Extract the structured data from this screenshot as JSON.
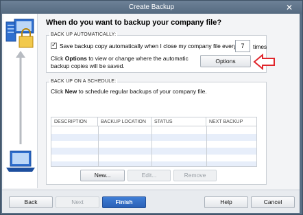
{
  "window": {
    "title": "Create Backup",
    "close_glyph": "✕"
  },
  "heading": "When do you want to backup your company file?",
  "auto_section": {
    "label": "BACK UP AUTOMATICALLY:",
    "checkbox_label": "Save backup copy automatically when I close my company file every",
    "times_value": "7",
    "times_label": "times",
    "description_prefix": "Click ",
    "description_bold": "Options",
    "description_rest_line1": " to view or change where the automatic",
    "description_line2": "backup copies will be saved.",
    "options_button": "Options"
  },
  "schedule_section": {
    "label": "BACK UP ON A SCHEDULE:",
    "description_prefix": "Click ",
    "description_bold": "New",
    "description_rest": " to schedule regular backups of your company file.",
    "columns": [
      "DESCRIPTION",
      "BACKUP LOCATION",
      "STATUS",
      "NEXT BACKUP"
    ],
    "rows": [
      [],
      [],
      [],
      [],
      [],
      []
    ],
    "buttons": {
      "new": "New...",
      "edit": "Edit...",
      "remove": "Remove"
    }
  },
  "footer": {
    "back": "Back",
    "next": "Next",
    "finish": "Finish",
    "help": "Help",
    "cancel": "Cancel"
  },
  "colors": {
    "accent": "#2a60b6",
    "arrow": "#e0262c",
    "title_bar": "#5f7389"
  }
}
